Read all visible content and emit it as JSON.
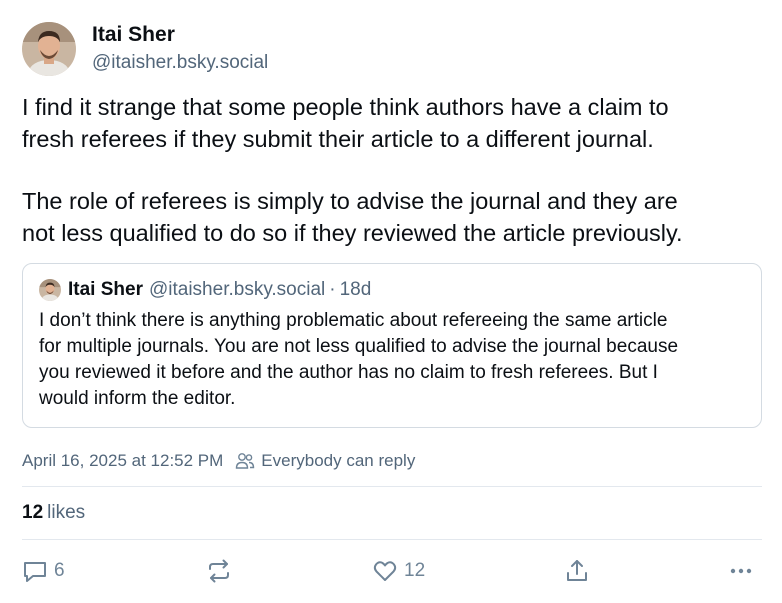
{
  "author": {
    "display_name": "Itai Sher",
    "handle": "@itaisher.bsky.social"
  },
  "post": {
    "paragraphs": [
      [
        "I find it strange that some people think authors have a claim to",
        "fresh referees if they submit their article to a different journal."
      ],
      [
        "The role of referees is simply to advise the journal and they are",
        "not less qualified to do so if they reviewed the article previously."
      ]
    ]
  },
  "quote": {
    "display_name": "Itai Sher",
    "handle": "@itaisher.bsky.social",
    "separator": "·",
    "age": "18d",
    "lines": [
      "I don’t think there is anything problematic about refereeing the same article",
      "for multiple journals. You are not less qualified to advise the journal because",
      "you reviewed it before and the author has no claim to fresh referees.  But I",
      "would inform the editor."
    ]
  },
  "meta": {
    "timestamp": "April 16, 2025 at 12:52 PM",
    "reply_setting": "Everybody can reply"
  },
  "likes": {
    "count": "12",
    "label": "likes"
  },
  "actions": {
    "reply_count": "6",
    "like_count": "12"
  },
  "icons": {
    "reply": "reply-bubble-icon",
    "repost": "repost-icon",
    "like": "heart-icon",
    "share": "share-upload-icon",
    "more": "more-dots-icon",
    "audience": "people-icon"
  },
  "colors": {
    "text": "#0b0f14",
    "muted": "#52667a",
    "icon": "#6f8497",
    "border": "#d4dbe2"
  }
}
